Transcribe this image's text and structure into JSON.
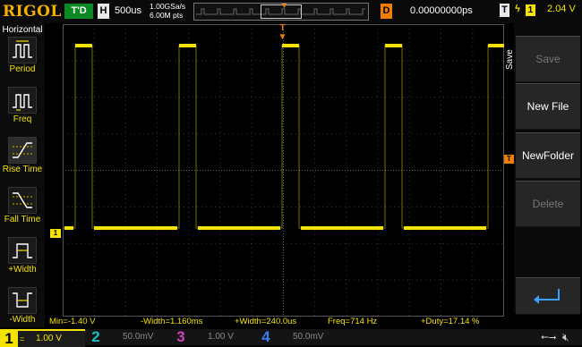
{
  "top": {
    "logo": "RIGOL",
    "trigger_status": "T'D",
    "h_label": "H",
    "timebase": "500us",
    "sample_rate": "1.00GSa/s",
    "memory_depth": "6.00M pts",
    "d_label": "D",
    "delay": "0.00000000ps",
    "t_label": "T",
    "trigger_channel": "1",
    "trigger_level": "2.04 V"
  },
  "left_menu": {
    "header": "Horizontal",
    "items": [
      {
        "label": "Period",
        "icon": "period-icon"
      },
      {
        "label": "Freq",
        "icon": "freq-icon"
      },
      {
        "label": "Rise Time",
        "icon": "rise-time-icon"
      },
      {
        "label": "Fall Time",
        "icon": "fall-time-icon"
      },
      {
        "label": "+Width",
        "icon": "positive-width-icon"
      },
      {
        "label": "-Width",
        "icon": "negative-width-icon"
      }
    ]
  },
  "right_menu": {
    "vertical_label": "Save",
    "keys": [
      {
        "label": "Save",
        "enabled": false
      },
      {
        "label": "New File",
        "enabled": true
      },
      {
        "label": "NewFolder",
        "enabled": true
      },
      {
        "label": "Delete",
        "enabled": false
      },
      {
        "label": "",
        "icon": "return-arrow-icon",
        "enabled": true
      }
    ]
  },
  "markers": {
    "channel1_ground": "1",
    "trigger_level_marker": "T",
    "trigger_position_marker": "T"
  },
  "measurements": {
    "min": "Min=-1.40 V",
    "neg_width": "-Width=1.160ms",
    "pos_width": "+Width=240.0us",
    "freq": "Freq=714 Hz",
    "duty": "+Duty=17.14 %"
  },
  "channels": [
    {
      "num": "1",
      "coupling": "=",
      "scale": "1.00 V",
      "color": "#f4e300",
      "active": true
    },
    {
      "num": "2",
      "coupling": "",
      "scale": "50.0mV",
      "color": "#16c0c0",
      "active": false
    },
    {
      "num": "3",
      "coupling": "",
      "scale": "1.00 V",
      "color": "#d040c0",
      "active": false
    },
    {
      "num": "4",
      "coupling": "",
      "scale": "50.0mV",
      "color": "#3c7cf0",
      "active": false
    }
  ],
  "status": {
    "usb_icon": "usb-icon",
    "speaker_icon": "speaker-muted-icon"
  },
  "colors": {
    "ch1": "#f4e300",
    "trigger": "#f07f00",
    "trigger_status_bg": "#0b8a24",
    "logo": "#f4b000"
  }
}
